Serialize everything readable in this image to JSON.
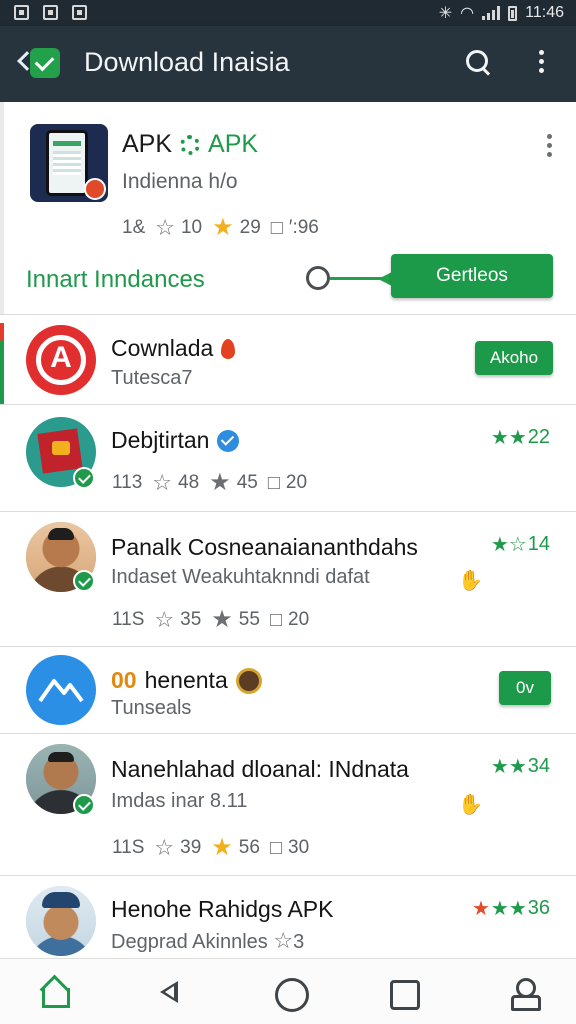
{
  "status_bar": {
    "time": "11:46"
  },
  "app_bar": {
    "title": "Download Inaisia"
  },
  "featured": {
    "name_prefix": "APK",
    "name_accent": "APK",
    "subtitle": "Indienna h/o",
    "stats": {
      "downloads": "1&",
      "stars_outline": "10",
      "stars_filled": "29",
      "likes": "′:96"
    },
    "install_label": "Innart Inndances",
    "install_button": "Gertleos"
  },
  "items": [
    {
      "name": "Cownlada",
      "subtitle": "Tutesca7",
      "action_button": "Akoho"
    },
    {
      "name": "Debjtirtan",
      "rating": "22",
      "stats": {
        "downloads": "113",
        "stars_outline": "48",
        "stars_filled": "45",
        "likes": "20"
      }
    },
    {
      "name": "Panalk Cosneanaiananthdahs",
      "subtitle": "Indaset Weakuhtaknndi dafat",
      "rating": "14",
      "stats": {
        "downloads": "11S",
        "stars_outline": "35",
        "stars_filled": "55",
        "likes": "20"
      }
    },
    {
      "name_prefix": "00",
      "name": "henenta",
      "subtitle": "Tunseals",
      "action_button": "0v"
    },
    {
      "name": "Nanehlahad dloanal: INdnata",
      "subtitle": "Imdas inar 8.11",
      "rating": "34",
      "stats": {
        "downloads": "11S",
        "stars_outline": "39",
        "stars_filled": "56",
        "likes": "30"
      }
    },
    {
      "name": "Henohe Rahidgs APK",
      "subtitle": "Degprad Akinnles",
      "subtitle_star": "3",
      "rating": "36"
    }
  ],
  "colors": {
    "accent": "#1f9a4b",
    "appbar": "#27343e",
    "star": "#f2b01e"
  },
  "icons": [
    "back-icon",
    "app-logo-icon",
    "search-icon",
    "more-icon",
    "home-icon",
    "nav-back-icon",
    "nav-home-circle-icon",
    "recents-icon",
    "profile-icon"
  ]
}
